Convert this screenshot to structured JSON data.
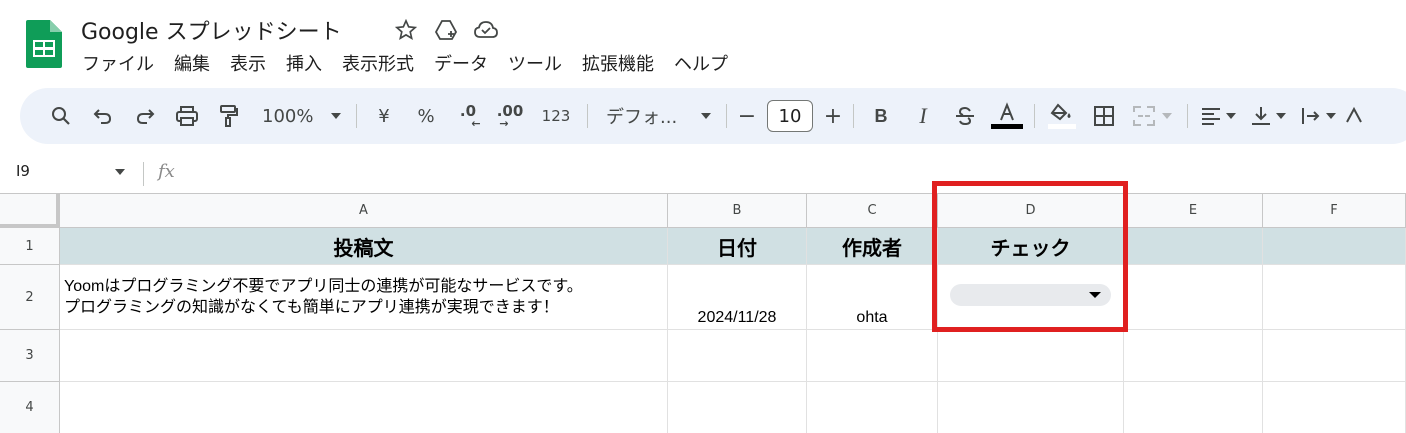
{
  "app": {
    "title": "Google スプレッドシート",
    "accent_color": "#0f9d58"
  },
  "menu": [
    "ファイル",
    "編集",
    "表示",
    "挿入",
    "表示形式",
    "データ",
    "ツール",
    "拡張機能",
    "ヘルプ"
  ],
  "toolbar": {
    "zoom": "100%",
    "currency": "¥",
    "percent": "%",
    "decrease_decimal": ".0",
    "increase_decimal": ".00",
    "number_format": "123",
    "font": "デフォ...",
    "font_size": "10",
    "minus": "−",
    "plus": "+",
    "bold": "B",
    "italic": "I"
  },
  "formula_bar": {
    "name_box": "I9",
    "fx": "fx"
  },
  "columns": [
    "A",
    "B",
    "C",
    "D",
    "E",
    "F"
  ],
  "rows": [
    "1",
    "2",
    "3",
    "4"
  ],
  "cells": {
    "A1": "投稿文",
    "B1": "日付",
    "C1": "作成者",
    "D1": "チェック",
    "A2_line1": "Yoomはプログラミング不要でアプリ同士の連携が可能なサービスです。",
    "A2_line2": "プログラミングの知識がなくても簡単にアプリ連携が実現できます！",
    "B2": "2024/11/28",
    "C2": "ohta"
  },
  "colors": {
    "header_fill": "#d0e0e3",
    "toolbar_bg": "#edf2fa",
    "highlight": "#e02020",
    "dropdown_chip": "#e8eaed"
  }
}
